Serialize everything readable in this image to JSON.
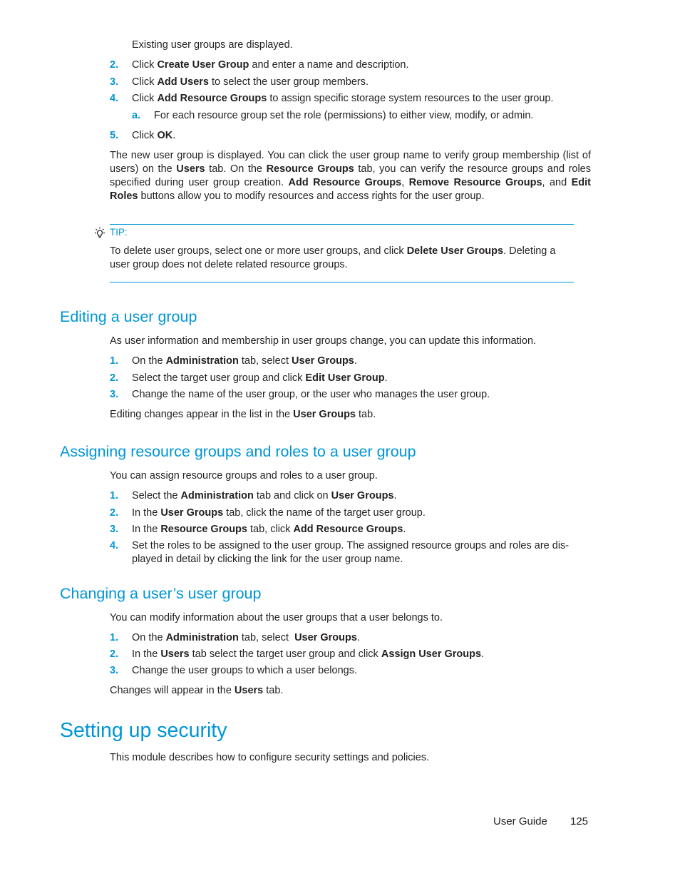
{
  "section1": {
    "intro_line": "Existing user groups are displayed.",
    "steps": [
      {
        "num": "2.",
        "parts": [
          {
            "t": "Click "
          },
          {
            "t": "Create User Group",
            "b": true
          },
          {
            "t": " and enter a name and description."
          }
        ]
      },
      {
        "num": "3.",
        "parts": [
          {
            "t": "Click "
          },
          {
            "t": "Add Users",
            "b": true
          },
          {
            "t": " to select the user group members."
          }
        ]
      },
      {
        "num": "4.",
        "parts": [
          {
            "t": "Click "
          },
          {
            "t": "Add Resource Groups",
            "b": true
          },
          {
            "t": " to assign specific storage system resources to the user group."
          }
        ]
      }
    ],
    "substep": {
      "num": "a.",
      "text": "For each resource group set the role (permissions) to either view, modify, or admin."
    },
    "step5": {
      "num": "5.",
      "parts": [
        {
          "t": "Click "
        },
        {
          "t": "OK",
          "b": true
        },
        {
          "t": "."
        }
      ]
    },
    "result_paragraph": [
      {
        "t": "The new user group is displayed. You can click the user group name to verify group membership (list of users) on the "
      },
      {
        "t": "Users",
        "b": true
      },
      {
        "t": " tab. On the "
      },
      {
        "t": "Resource Groups",
        "b": true
      },
      {
        "t": " tab, you can verify the resource groups and roles specified during user group creation. "
      },
      {
        "t": "Add Resource Groups",
        "b": true
      },
      {
        "t": ", "
      },
      {
        "t": "Remove Resource Groups",
        "b": true
      },
      {
        "t": ", and "
      },
      {
        "t": "Edit Roles",
        "b": true
      },
      {
        "t": " buttons allow you to modify resources and access rights for the user group."
      }
    ]
  },
  "tip": {
    "icon": "lightbulb-icon",
    "label": "TIP:",
    "parts": [
      {
        "t": "To delete user groups, select one or more user groups, and click "
      },
      {
        "t": "Delete User Groups",
        "b": true
      },
      {
        "t": ". Deleting a user group does not delete related resource groups."
      }
    ]
  },
  "editing": {
    "heading": "Editing a user group",
    "intro": "As user information and membership in user groups change, you can update this information.",
    "steps": [
      {
        "num": "1.",
        "parts": [
          {
            "t": "On the "
          },
          {
            "t": "Administration",
            "b": true
          },
          {
            "t": " tab, select "
          },
          {
            "t": "User Groups",
            "b": true
          },
          {
            "t": "."
          }
        ]
      },
      {
        "num": "2.",
        "parts": [
          {
            "t": "Select the target user group and click "
          },
          {
            "t": "Edit User Group",
            "b": true
          },
          {
            "t": "."
          }
        ]
      },
      {
        "num": "3.",
        "parts": [
          {
            "t": "Change the name of the user group, or the user who manages the user group."
          }
        ]
      }
    ],
    "outro": [
      {
        "t": "Editing changes appear in the list in the "
      },
      {
        "t": "User Groups",
        "b": true
      },
      {
        "t": " tab."
      }
    ]
  },
  "assigning": {
    "heading": "Assigning resource groups and roles to a user group",
    "intro": "You can assign resource groups and roles to a user group.",
    "steps": [
      {
        "num": "1.",
        "parts": [
          {
            "t": "Select the "
          },
          {
            "t": "Administration",
            "b": true
          },
          {
            "t": " tab and click on "
          },
          {
            "t": "User Groups",
            "b": true
          },
          {
            "t": "."
          }
        ]
      },
      {
        "num": "2.",
        "parts": [
          {
            "t": "In the "
          },
          {
            "t": "User Groups",
            "b": true
          },
          {
            "t": " tab, click the name of the target user group."
          }
        ]
      },
      {
        "num": "3.",
        "parts": [
          {
            "t": "In the "
          },
          {
            "t": "Resource Groups",
            "b": true
          },
          {
            "t": " tab, click "
          },
          {
            "t": "Add Resource Groups",
            "b": true
          },
          {
            "t": "."
          }
        ]
      },
      {
        "num": "4.",
        "parts": [
          {
            "t": "Set the roles to be assigned to the user group. The assigned resource groups and roles are dis- played in detail by clicking the link for the user group name."
          }
        ]
      }
    ]
  },
  "changing": {
    "heading": "Changing a user’s user group",
    "intro": "You can modify information about the user groups that a user belongs to.",
    "steps": [
      {
        "num": "1.",
        "parts": [
          {
            "t": "On the "
          },
          {
            "t": "Administration",
            "b": true
          },
          {
            "t": " tab, select  "
          },
          {
            "t": "User Groups",
            "b": true
          },
          {
            "t": "."
          }
        ]
      },
      {
        "num": "2.",
        "parts": [
          {
            "t": "In the "
          },
          {
            "t": "Users",
            "b": true
          },
          {
            "t": " tab select the target user group and click "
          },
          {
            "t": "Assign User Groups",
            "b": true
          },
          {
            "t": "."
          }
        ]
      },
      {
        "num": "3.",
        "parts": [
          {
            "t": "Change the user groups to which a user belongs."
          }
        ]
      }
    ],
    "outro": [
      {
        "t": "Changes will appear in the "
      },
      {
        "t": "Users",
        "b": true
      },
      {
        "t": " tab."
      }
    ]
  },
  "security": {
    "heading": "Setting up security",
    "intro": "This module describes how to configure security settings and policies."
  },
  "footer": {
    "guide_label": "User Guide",
    "page_number": "125"
  },
  "colors": {
    "accent": "#0096d6",
    "text": "#231f20"
  }
}
